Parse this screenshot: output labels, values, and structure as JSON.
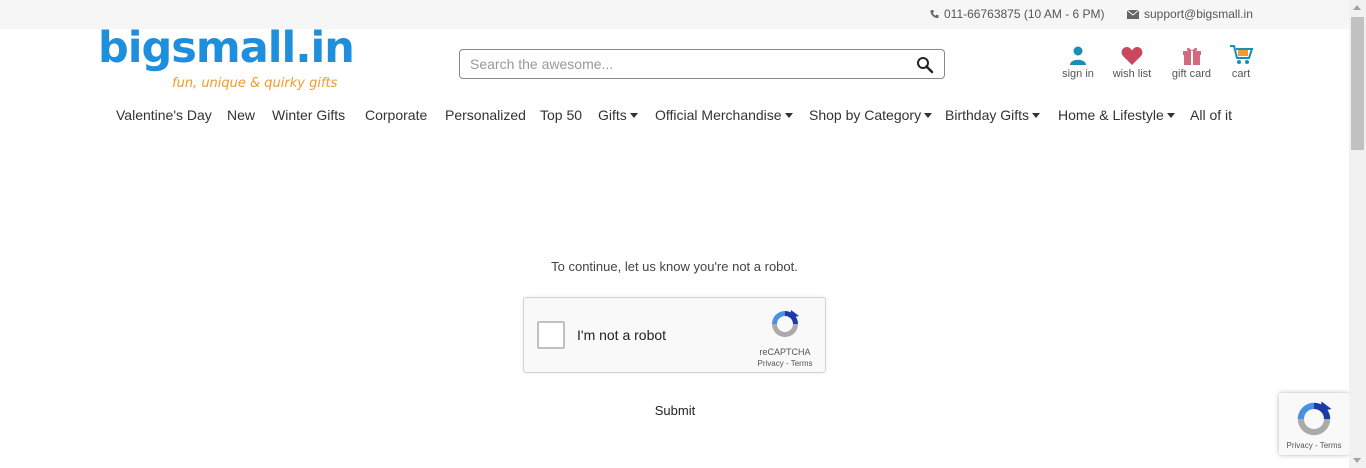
{
  "topbar": {
    "phone": "011-66763875 (10 AM - 6 PM)",
    "email": "support@bigsmall.in"
  },
  "logo": {
    "wordmark": "bigsmall.in",
    "tagline": "fun, unique & quirky gifts"
  },
  "search": {
    "placeholder": "Search the awesome...",
    "value": "",
    "button_icon": "search-icon"
  },
  "user_icons": [
    {
      "label": "sign in",
      "icon": "user-icon"
    },
    {
      "label": "wish list",
      "icon": "heart-icon"
    },
    {
      "label": "gift card",
      "icon": "gift-icon"
    },
    {
      "label": "cart",
      "icon": "cart-icon"
    }
  ],
  "nav": [
    {
      "label": "Valentine's Day",
      "dropdown": false
    },
    {
      "label": "New",
      "dropdown": false
    },
    {
      "label": "Winter Gifts",
      "dropdown": false
    },
    {
      "label": "Corporate",
      "dropdown": false
    },
    {
      "label": "Personalized",
      "dropdown": false
    },
    {
      "label": "Top 50",
      "dropdown": false
    },
    {
      "label": "Gifts",
      "dropdown": true
    },
    {
      "label": "Official Merchandise",
      "dropdown": true
    },
    {
      "label": "Shop by Category",
      "dropdown": true
    },
    {
      "label": "Birthday Gifts",
      "dropdown": true
    },
    {
      "label": "Home & Lifestyle",
      "dropdown": true
    },
    {
      "label": "All of it",
      "dropdown": false
    }
  ],
  "main": {
    "prompt": "To continue, let us know you're not a robot.",
    "captcha_label": "I'm not a robot",
    "captcha_brand": "reCAPTCHA",
    "captcha_links": "Privacy - Terms",
    "submit_label": "Submit"
  },
  "badge": {
    "links": "Privacy - Terms"
  },
  "colors": {
    "brand_blue": "#1e8fdc",
    "brand_orange": "#f39a2c",
    "user_icon": "#1a8fb5",
    "heart_icon": "#c9485e",
    "gift_icon": "#d2697f",
    "recaptcha_blue": "#4a90e2",
    "recaptcha_dark": "#1c3aa9",
    "recaptcha_gray": "#aaaaaa"
  }
}
